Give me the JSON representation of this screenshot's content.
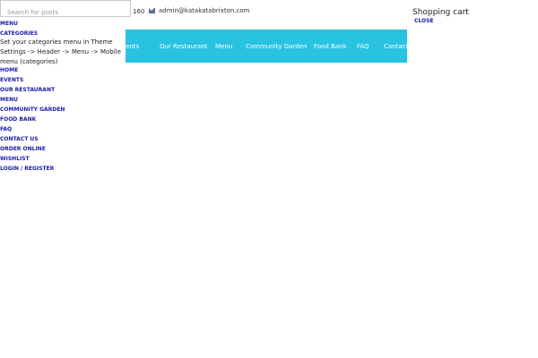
{
  "topbar": {
    "phone_fragment": "160",
    "email": "admin@katakatabrixton.com",
    "email_icon": "envelope-icon"
  },
  "main_nav": {
    "items": [
      "ents",
      "Our Restaurant",
      "Menu",
      "Community Garden",
      "Food Bank",
      "FAQ",
      "Contact"
    ]
  },
  "mobile_panel": {
    "search_placeholder": "Search for posts",
    "tabs": [
      "MENU",
      "CATEGORIES"
    ],
    "note": "Set your categories menu in Theme Settings -> Header -> Menu -> Mobile menu (categories)",
    "menu": [
      "HOME",
      "EVENTS",
      "OUR RESTAURANT",
      "MENU",
      "COMMUNITY GARDEN",
      "FOOD BANK",
      "FAQ",
      "CONTACT US",
      "ORDER ONLINE",
      "WISHLIST",
      "LOGIN / REGISTER"
    ]
  },
  "cart": {
    "title": "Shopping cart",
    "close_label": "CLOSE"
  },
  "colors": {
    "nav_bg": "#29c3e1",
    "link": "#1a1aa6"
  }
}
